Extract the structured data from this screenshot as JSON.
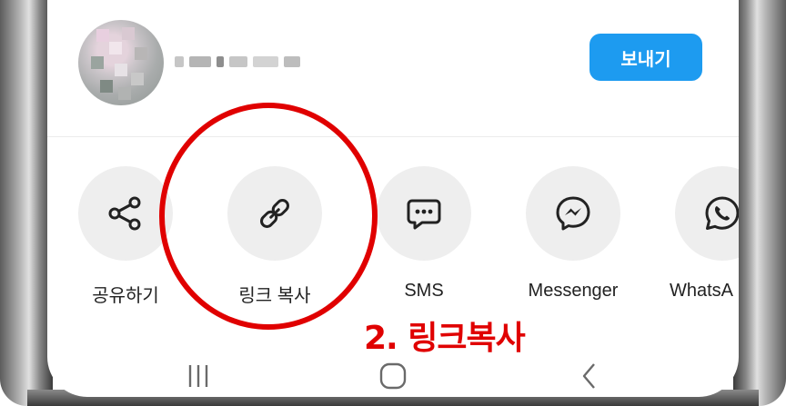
{
  "contact": {
    "name": "",
    "send_button": "보내기"
  },
  "share_options": [
    {
      "label": "공유하기",
      "icon": "share-icon"
    },
    {
      "label": "링크 복사",
      "icon": "link-icon"
    },
    {
      "label": "SMS",
      "icon": "sms-icon"
    },
    {
      "label": "Messenger",
      "icon": "messenger-icon"
    },
    {
      "label": "WhatsA",
      "icon": "whatsapp-icon"
    }
  ],
  "annotation": {
    "text": "2. 링크복사",
    "color": "#e00000"
  },
  "nav": {
    "icons": [
      "recent-apps-icon",
      "home-icon",
      "back-icon"
    ]
  },
  "colors": {
    "accent": "#1d9bf0",
    "option_bg": "#eeeeee"
  }
}
